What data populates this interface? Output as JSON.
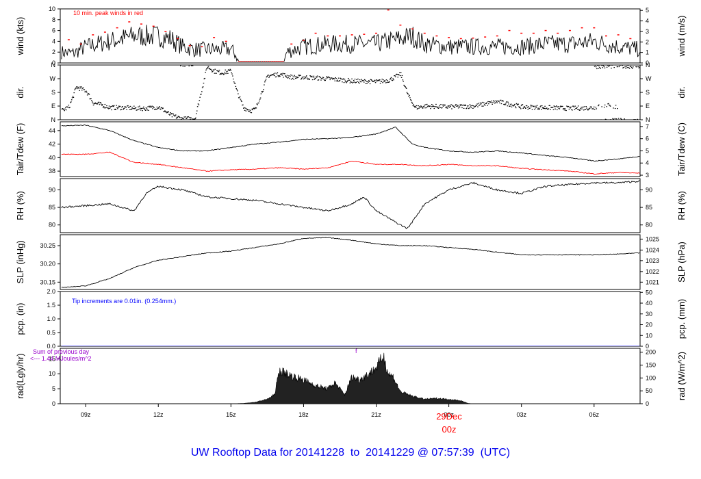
{
  "title": "UW Rooftop Data for 20141228  to  20141229 @ 07:57:39  (UTC)",
  "date_marker": {
    "day": "29Dec",
    "hour": "00z",
    "color": "#ff0000"
  },
  "chart_data": {
    "type": "line",
    "x_unit": "hours after 08z 2014-12-28",
    "x_range": [
      -0.05,
      23.9
    ],
    "x_ticks": [
      {
        "h": 1,
        "label": "09z"
      },
      {
        "h": 4,
        "label": "12z"
      },
      {
        "h": 7,
        "label": "15z"
      },
      {
        "h": 10,
        "label": "18z"
      },
      {
        "h": 13,
        "label": "21z"
      },
      {
        "h": 16,
        "label": "00z"
      },
      {
        "h": 19,
        "label": "03z"
      },
      {
        "h": 22,
        "label": "06z"
      }
    ],
    "panels": [
      {
        "id": "wind",
        "ylabel": "wind (kts)",
        "ylabel_right": "wind (m/s)",
        "ylim": [
          0,
          10
        ],
        "yticks": [
          "0",
          "2",
          "4",
          "6",
          "8",
          "10"
        ],
        "ytick_values": [
          0,
          2,
          4,
          6,
          8,
          10
        ],
        "right_ticks": [
          "0",
          "1",
          "2",
          "3",
          "4",
          "5"
        ],
        "right_tick_values": [
          0,
          1.944,
          3.888,
          5.832,
          7.776,
          9.72
        ],
        "annotation": "10 min. peak winds in red",
        "series": [
          {
            "name": "wind speed",
            "color": "#000000",
            "x": [
              0,
              0.5,
              1,
              1.5,
              2,
              2.5,
              3,
              3.5,
              4,
              4.5,
              5,
              5.5,
              6,
              6.5,
              7,
              7.2,
              7.3,
              9.2,
              9.3,
              10,
              11,
              12,
              13,
              14,
              14.5,
              15,
              16,
              17,
              18,
              19,
              20,
              21,
              22,
              23,
              23.9
            ],
            "y": [
              2,
              1.8,
              3,
              3.5,
              4,
              4.5,
              5,
              5,
              5,
              4.5,
              3,
              2.5,
              2.5,
              2.5,
              2.5,
              1.5,
              0.3,
              0.3,
              2,
              3,
              3.5,
              3.5,
              3.5,
              4.5,
              5,
              3.5,
              3,
              3,
              3,
              3,
              3.5,
              3.5,
              4,
              3,
              2.5
            ]
          },
          {
            "name": "10 min. peak",
            "color": "#ff0000",
            "style": "dash-markers",
            "x": [
              0.3,
              0.8,
              1.3,
              1.8,
              2.3,
              2.8,
              3.3,
              3.8,
              4.3,
              4.8,
              5.3,
              5.8,
              6.3,
              6.8,
              9.5,
              10,
              10.5,
              11,
              11.5,
              12,
              12.5,
              13,
              13.5,
              14,
              14.5,
              15,
              15.5,
              16,
              16.5,
              17,
              17.5,
              18,
              18.5,
              19,
              19.5,
              20,
              20.5,
              21,
              21.5,
              22,
              22.5,
              23,
              23.5
            ],
            "y": [
              4.3,
              3.5,
              5.2,
              5.7,
              6.5,
              7.6,
              7.2,
              6.8,
              5.8,
              4.5,
              3.2,
              3.0,
              4.7,
              4.0,
              3.5,
              4.2,
              5.5,
              5.0,
              5.0,
              5.2,
              5.3,
              5.5,
              9.8,
              7.0,
              6.3,
              5.5,
              5.0,
              4.7,
              4.5,
              4.6,
              4.8,
              5.0,
              6.0,
              5.5,
              5.5,
              6.0,
              5.5,
              6.0,
              6.5,
              6.5,
              5.0,
              5.2,
              4.5
            ]
          }
        ]
      },
      {
        "id": "dir",
        "ylabel": "dir.",
        "ylabel_right": "dir.",
        "ylim": [
          0,
          360
        ],
        "yticks": [
          "N",
          "E",
          "S",
          "W",
          "N"
        ],
        "ytick_values": [
          0,
          90,
          180,
          270,
          360
        ],
        "right_ticks": [
          "N",
          "E",
          "S",
          "W",
          "N"
        ],
        "right_tick_values": [
          0,
          90,
          180,
          270,
          360
        ],
        "series": [
          {
            "name": "wind direction",
            "color": "#000000",
            "style": "scatter",
            "x": [
              0,
              0.3,
              0.6,
              1,
              1.3,
              1.6,
              2,
              2.5,
              3,
              3.5,
              4,
              4.5,
              5,
              5.5,
              6,
              6.3,
              6.6,
              7,
              7.2,
              7.5,
              7.8,
              8,
              8.5,
              9,
              9.5,
              10,
              11,
              12,
              13,
              13.5,
              14,
              14.3,
              14.6,
              15,
              16,
              17,
              18,
              19,
              20,
              21,
              22,
              22.5,
              23
            ],
            "y": [
              60,
              85,
              215,
              190,
              110,
              100,
              80,
              80,
              75,
              75,
              85,
              30,
              5,
              10,
              350,
              320,
              310,
              320,
              200,
              80,
              60,
              70,
              290,
              300,
              280,
              280,
              270,
              255,
              250,
              260,
              300,
              160,
              80,
              90,
              85,
              90,
              120,
              85,
              80,
              75,
              80,
              95,
              80
            ]
          },
          {
            "name": "late N cluster",
            "color": "#000000",
            "style": "scatter",
            "x": [
              22,
              22.5,
              23,
              23.5,
              23.9
            ],
            "y": [
              350,
              352,
              355,
              350,
              355
            ]
          }
        ]
      },
      {
        "id": "temp",
        "ylabel": "Tair/Tdew (F)",
        "ylabel_right": "Tair/Tdew (C)",
        "ylim": [
          37.2,
          45.3
        ],
        "yticks": [
          "38",
          "40",
          "42",
          "44"
        ],
        "ytick_values": [
          38,
          40,
          42,
          44
        ],
        "right_ticks": [
          "3",
          "4",
          "5",
          "6",
          "7"
        ],
        "right_tick_values": [
          37.4,
          39.2,
          41,
          42.8,
          44.6
        ],
        "series": [
          {
            "name": "Tair",
            "color": "#000000",
            "x": [
              0,
              1,
              2,
              3,
              4,
              5,
              6,
              7,
              8,
              9,
              10,
              11,
              12,
              13,
              13.8,
              14.5,
              15,
              16,
              17,
              18,
              19,
              20,
              21,
              22,
              23,
              23.9
            ],
            "y": [
              44.7,
              44.8,
              44,
              42.5,
              41.5,
              41,
              41,
              41.5,
              42,
              42.3,
              42.7,
              42.8,
              43,
              43.5,
              44.5,
              42,
              41.5,
              41,
              40.8,
              41,
              40.7,
              40.3,
              40,
              39.5,
              39.8,
              40.2
            ]
          },
          {
            "name": "Tdew",
            "color": "#ff0000",
            "x": [
              0,
              1,
              2,
              3,
              4,
              5,
              6,
              7,
              8,
              9,
              10,
              11,
              12,
              13,
              14,
              15,
              16,
              17,
              18,
              19,
              20,
              21,
              22,
              23,
              23.9
            ],
            "y": [
              40.5,
              40.5,
              40.8,
              39.3,
              39,
              38.5,
              38,
              38.2,
              38.3,
              38.5,
              38.3,
              38.5,
              39.5,
              39,
              39,
              38.8,
              39,
              38.8,
              38.8,
              38.4,
              38.2,
              38,
              37.6,
              37.8,
              37.7
            ]
          }
        ]
      },
      {
        "id": "rh",
        "ylabel": "RH (%)",
        "ylabel_right": "RH (%)",
        "ylim": [
          77.8,
          93.2
        ],
        "yticks": [
          "80",
          "85",
          "90"
        ],
        "ytick_values": [
          80,
          85,
          90
        ],
        "right_ticks": [
          "80",
          "85",
          "90"
        ],
        "right_tick_values": [
          80,
          85,
          90
        ],
        "series": [
          {
            "name": "RH",
            "color": "#000000",
            "x": [
              0,
              1,
              2,
              3,
              3.5,
              4,
              5,
              6,
              7,
              8,
              9,
              10,
              11,
              12,
              12.5,
              13,
              14,
              14.3,
              15,
              16,
              17,
              18,
              19,
              20,
              21,
              22,
              23,
              23.9
            ],
            "y": [
              85,
              85.5,
              86,
              84,
              89,
              91,
              90,
              88,
              87.5,
              87,
              86,
              85,
              84,
              86,
              88,
              84,
              80,
              79,
              86,
              90,
              92,
              90,
              89,
              91,
              91.5,
              92,
              92,
              92.5
            ]
          }
        ]
      },
      {
        "id": "slp",
        "ylabel": "SLP (inHg)",
        "ylabel_right": "SLP (hPa)",
        "ylim": [
          30.13,
          30.28
        ],
        "yticks": [
          "30.15",
          "30.20",
          "30.25"
        ],
        "ytick_values": [
          30.15,
          30.2,
          30.25
        ],
        "right_ticks": [
          "1021",
          "1022",
          "1023",
          "1024",
          "1025"
        ],
        "right_tick_values": [
          30.15,
          30.179,
          30.209,
          30.238,
          30.268
        ],
        "series": [
          {
            "name": "SLP",
            "color": "#000000",
            "x": [
              0,
              1,
              2,
              3,
              4,
              5,
              6,
              7,
              8,
              9,
              10,
              11,
              12,
              13,
              14,
              15,
              16,
              17,
              18,
              19,
              20,
              21,
              22,
              23,
              23.9
            ],
            "y": [
              30.135,
              30.14,
              30.16,
              30.19,
              30.21,
              30.22,
              30.23,
              30.235,
              30.245,
              30.255,
              30.27,
              30.272,
              30.265,
              30.255,
              30.25,
              30.25,
              30.245,
              30.24,
              30.232,
              30.225,
              30.225,
              30.225,
              30.225,
              30.227,
              30.23
            ]
          }
        ]
      },
      {
        "id": "pcp",
        "ylabel": "pcp. (in)",
        "ylabel_right": "pcp. (mm)",
        "ylim": [
          0,
          2.0
        ],
        "yticks": [
          "0.0",
          "0.5",
          "1.0",
          "1.5",
          "2.0"
        ],
        "ytick_values": [
          0,
          0.5,
          1,
          1.5,
          2
        ],
        "right_ticks": [
          "0",
          "10",
          "20",
          "30",
          "40",
          "50"
        ],
        "right_tick_values": [
          0,
          0.3937,
          0.7874,
          1.1811,
          1.5748,
          1.9685
        ],
        "annotation": "Tip increments are 0.01in. (0.254mm.)",
        "series": [
          {
            "name": "precip",
            "color": "#0000ff",
            "x": [
              0,
              23.9
            ],
            "y": [
              0,
              0
            ]
          }
        ]
      },
      {
        "id": "rad",
        "ylabel": "rad(Lgly/hr)",
        "ylabel_right": "rad (W/m^2)",
        "ylim": [
          0,
          18.5
        ],
        "yticks": [
          "0",
          "5",
          "10",
          "15"
        ],
        "ytick_values": [
          0,
          5,
          10,
          15
        ],
        "right_ticks": [
          "0",
          "50",
          "100",
          "150",
          "200"
        ],
        "right_tick_values": [
          0,
          4.3,
          8.6,
          12.9,
          17.2
        ],
        "annotation_lines": [
          "Sum of previous day",
          "<--- 1.44 MJoules/m^2"
        ],
        "marker_text": "f",
        "series": [
          {
            "name": "solar radiation",
            "color": "#000000",
            "style": "area",
            "x": [
              0,
              7,
              7.5,
              8,
              8.5,
              8.8,
              9,
              9.3,
              9.6,
              10,
              10.5,
              11,
              11.3,
              11.7,
              12,
              12.3,
              12.7,
              13,
              13.3,
              13.5,
              13.7,
              14,
              14.5,
              15,
              15.5,
              16,
              16.5,
              16.8,
              17,
              23.9
            ],
            "y": [
              0,
              0,
              0.1,
              0.5,
              1.5,
              3,
              11,
              10,
              9,
              8,
              6,
              5,
              7,
              3,
              9,
              8,
              10,
              12,
              16,
              10,
              9,
              4,
              2.5,
              1.5,
              1.8,
              1.5,
              1,
              0.1,
              0,
              0
            ]
          }
        ]
      }
    ]
  }
}
